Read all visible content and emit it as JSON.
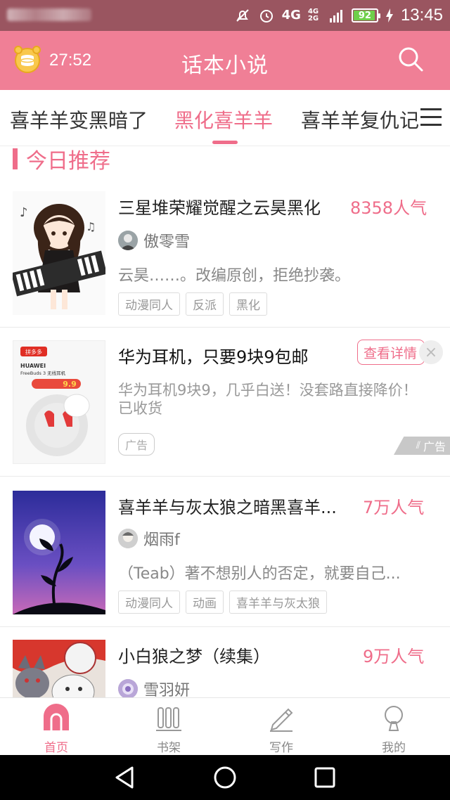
{
  "status_bar": {
    "network": "4G",
    "network_small": "4G 2G",
    "battery": "92",
    "time": "13:45"
  },
  "header": {
    "timer": "27:52",
    "title": "话本小说"
  },
  "tabs": [
    {
      "label": "喜羊羊变黑暗了"
    },
    {
      "label": "黑化喜羊羊",
      "active": true
    },
    {
      "label": "喜羊羊复仇记"
    }
  ],
  "section": {
    "title": "今日推荐"
  },
  "books": [
    {
      "title": "三星堆荣耀觉醒之云昊黑化",
      "popularity": "8358人气",
      "author": "傲零雪",
      "description": "云昊……。改编原创，拒绝抄袭。",
      "tags": [
        "动漫同人",
        "反派",
        "黑化"
      ]
    },
    {
      "title": "喜羊羊与灰太狼之暗黑喜羊...",
      "popularity": "7万人气",
      "author": "烟雨f",
      "description": "（Teab）著不想别人的否定，就要自己...",
      "tags": [
        "动漫同人",
        "动画",
        "喜羊羊与灰太狼"
      ]
    },
    {
      "title": "小白狼之梦（续集）",
      "popularity": "9万人气",
      "author": "雪羽妍",
      "description": "",
      "tags": []
    }
  ],
  "ad": {
    "title": "华为耳机，只要9块9包邮",
    "cta": "查看详情",
    "close": "×",
    "description": "华为耳机9块9，几乎白送！没套路直接降价！已收货",
    "label": "广告",
    "corner_label": "广告",
    "image_text": {
      "brand": "拼多多",
      "product_brand": "HUAWEI",
      "product": "FreeBuds 3 无线耳机",
      "price": "9.9"
    }
  },
  "bottom_nav": [
    {
      "label": "首页",
      "icon": "home-icon",
      "active": true
    },
    {
      "label": "书架",
      "icon": "bookshelf-icon"
    },
    {
      "label": "写作",
      "icon": "pen-icon"
    },
    {
      "label": "我的",
      "icon": "profile-icon"
    }
  ],
  "colors": {
    "accent": "#ef6d8a",
    "header": "#f07f96",
    "status_bar": "#9a5560"
  }
}
